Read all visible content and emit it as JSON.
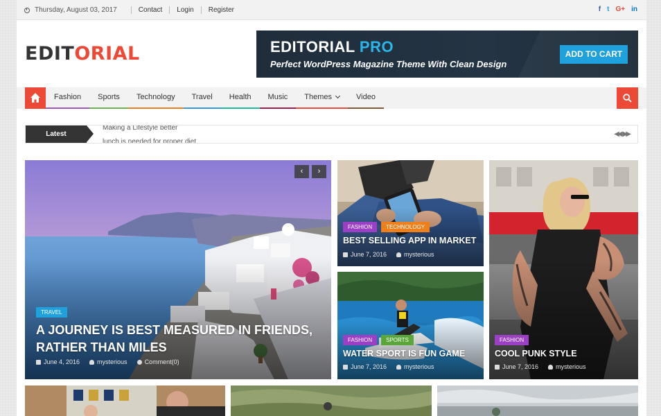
{
  "topbar": {
    "date": "Thursday, August 03, 2017",
    "links": [
      "Contact",
      "Login",
      "Register"
    ],
    "social": [
      "f",
      "t",
      "G+",
      "in"
    ]
  },
  "logo": {
    "part1": "EDIT",
    "part2": "ORIAL"
  },
  "banner": {
    "title1": "EDITORIAL",
    "title2": "PRO",
    "subtitle": "Perfect  WordPress Magazine Theme With Clean Design",
    "cta": "ADD TO CART"
  },
  "nav": {
    "items": [
      {
        "label": "Fashion",
        "color": "#9b59b6"
      },
      {
        "label": "Sports",
        "color": "#6ab04c"
      },
      {
        "label": "Technology",
        "color": "#e67e22"
      },
      {
        "label": "Travel",
        "color": "#3498db"
      },
      {
        "label": "Health",
        "color": "#1abc9c"
      },
      {
        "label": "Music",
        "color": "#9c1f4a"
      },
      {
        "label": "Themes",
        "color": "#e74c3c"
      },
      {
        "label": "Video",
        "color": "#7d5a3c"
      }
    ]
  },
  "ticker": {
    "label": "Latest",
    "items": [
      "Making a Lifestyle better",
      "lunch is needed for proper diet"
    ]
  },
  "featured": {
    "main": {
      "tag": "TRAVEL",
      "title_line1": "A JOURNEY IS BEST MEASURED IN FRIENDS,",
      "title_line2": "RATHER THAN MILES",
      "date": "June 4, 2016",
      "author": "mysterious",
      "comments": "Comment(0)"
    },
    "top_right": {
      "tags": [
        "FASHION",
        "TECHNOLOGY"
      ],
      "title": "BEST SELLING APP IN MARKET",
      "date": "June 7, 2016",
      "author": "mysterious"
    },
    "bottom_right": {
      "tags": [
        "FASHION",
        "SPORTS"
      ],
      "title": "WATER SPORT IS FUN GAME",
      "date": "June 7, 2016",
      "author": "mysterious"
    },
    "tall": {
      "tags": [
        "FASHION"
      ],
      "title": "COOL PUNK STYLE",
      "date": "June 7, 2016",
      "author": "mysterious"
    }
  },
  "colors": {
    "accent": "#ec4a36",
    "fashion": "#9b3fc4",
    "technology": "#ef7f1a",
    "sports": "#5aa63a",
    "travel": "#1ea1dd"
  }
}
